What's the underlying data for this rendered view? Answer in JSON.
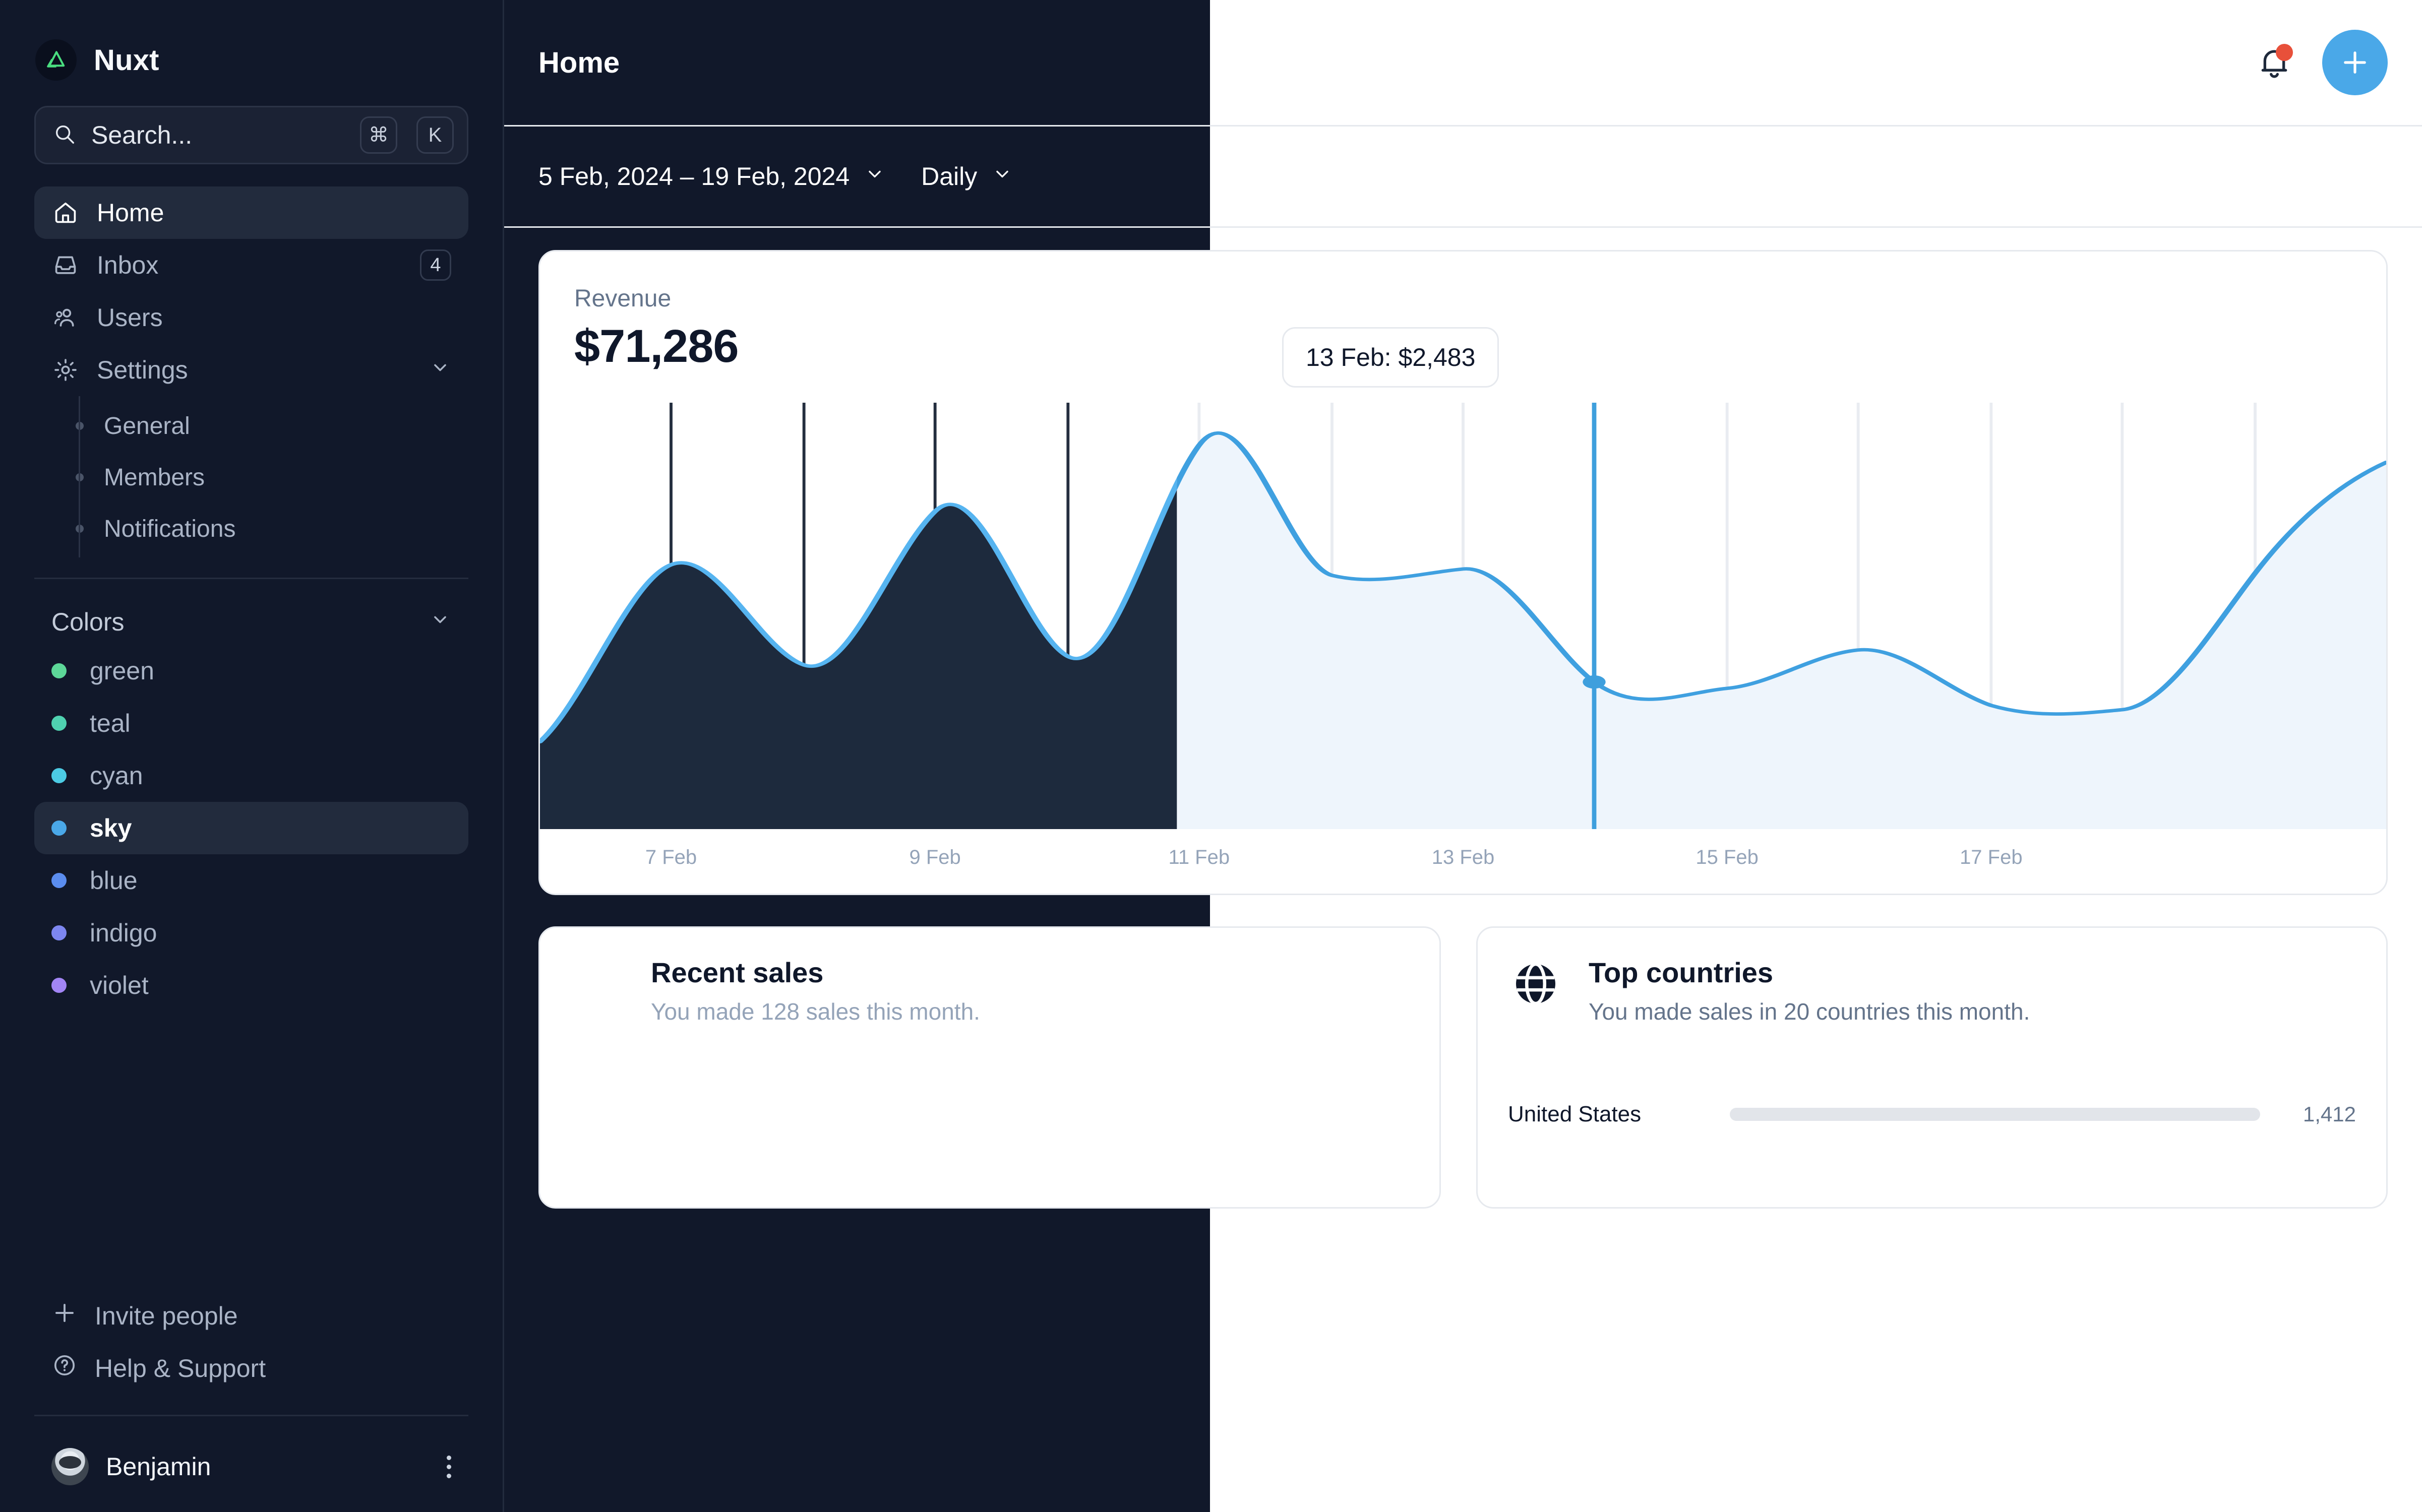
{
  "brand": {
    "name": "Nuxt",
    "logo_icon": "nuxt-logo-icon"
  },
  "search": {
    "placeholder": "Search...",
    "kbd_modifier": "⌘",
    "kbd_key": "K"
  },
  "sidebar": {
    "nav": [
      {
        "label": "Home",
        "icon": "home-icon",
        "active": true,
        "badge": ""
      },
      {
        "label": "Inbox",
        "icon": "inbox-icon",
        "active": false,
        "badge": "4"
      },
      {
        "label": "Users",
        "icon": "users-icon",
        "active": false,
        "badge": ""
      },
      {
        "label": "Settings",
        "icon": "gear-icon",
        "active": false,
        "badge": "",
        "expanded": true
      }
    ],
    "settings_children": [
      "General",
      "Members",
      "Notifications"
    ],
    "colors_section": {
      "label": "Colors",
      "chevron": "chevron-down-icon"
    },
    "colors": [
      {
        "label": "green",
        "hex": "#5dd798",
        "active": false
      },
      {
        "label": "teal",
        "hex": "#4fd1b0",
        "active": false
      },
      {
        "label": "cyan",
        "hex": "#4ccbe4",
        "active": false
      },
      {
        "label": "sky",
        "hex": "#4aa8e8",
        "active": true
      },
      {
        "label": "blue",
        "hex": "#5b8def",
        "active": false
      },
      {
        "label": "indigo",
        "hex": "#7d86f0",
        "active": false
      },
      {
        "label": "violet",
        "hex": "#a285f5",
        "active": false
      }
    ],
    "footer": [
      {
        "label": "Invite people",
        "icon": "plus-icon"
      },
      {
        "label": "Help & Support",
        "icon": "question-circle-icon"
      }
    ],
    "profile": {
      "name": "Benjamin",
      "menu_icon": "more-vertical-icon",
      "avatar": "user-avatar"
    }
  },
  "header": {
    "title": "Home",
    "notifications_icon": "bell-icon",
    "has_unread": true,
    "add_icon": "plus-icon",
    "accent": "#4aa8e8"
  },
  "filters": {
    "date_range": "5 Feb, 2024 – 19 Feb, 2024",
    "interval": "Daily",
    "chevron": "chevron-down-icon"
  },
  "revenue_card": {
    "label": "Revenue",
    "value": "$71,286",
    "tooltip": "13 Feb: $2,483"
  },
  "cards": [
    {
      "title": "Recent sales",
      "subtitle": "You made 128 sales this month.",
      "icon": "bar-chart-icon"
    },
    {
      "title": "Top countries",
      "subtitle": "You made sales in 20 countries this month.",
      "icon": "globe-icon"
    }
  ],
  "chart_data": {
    "type": "area",
    "title": "Revenue",
    "xlabel": "",
    "ylabel": "",
    "grid": true,
    "legend": false,
    "line_color": "#4aa8e8",
    "fill_color_light": "#eef5fc",
    "fill_color_dark": "#1b2739",
    "tick_labels": [
      "7 Feb",
      "9 Feb",
      "11 Feb",
      "13 Feb",
      "15 Feb",
      "17 Feb"
    ],
    "x": [
      "5 Feb",
      "6 Feb",
      "7 Feb",
      "8 Feb",
      "9 Feb",
      "10 Feb",
      "11 Feb",
      "12 Feb",
      "13 Feb",
      "14 Feb",
      "15 Feb",
      "16 Feb",
      "17 Feb",
      "18 Feb",
      "19 Feb"
    ],
    "values": [
      1120,
      2980,
      3860,
      3160,
      4210,
      2810,
      5030,
      3360,
      2483,
      2720,
      2530,
      3240,
      2620,
      2240,
      4700
    ],
    "highlight": {
      "x": "13 Feb",
      "value": 2483,
      "label": "13 Feb: $2,483"
    },
    "ylim": [
      0,
      5400
    ]
  },
  "countries_rows": [
    {
      "name": "United States",
      "pct": 28,
      "value": "1,412"
    }
  ]
}
